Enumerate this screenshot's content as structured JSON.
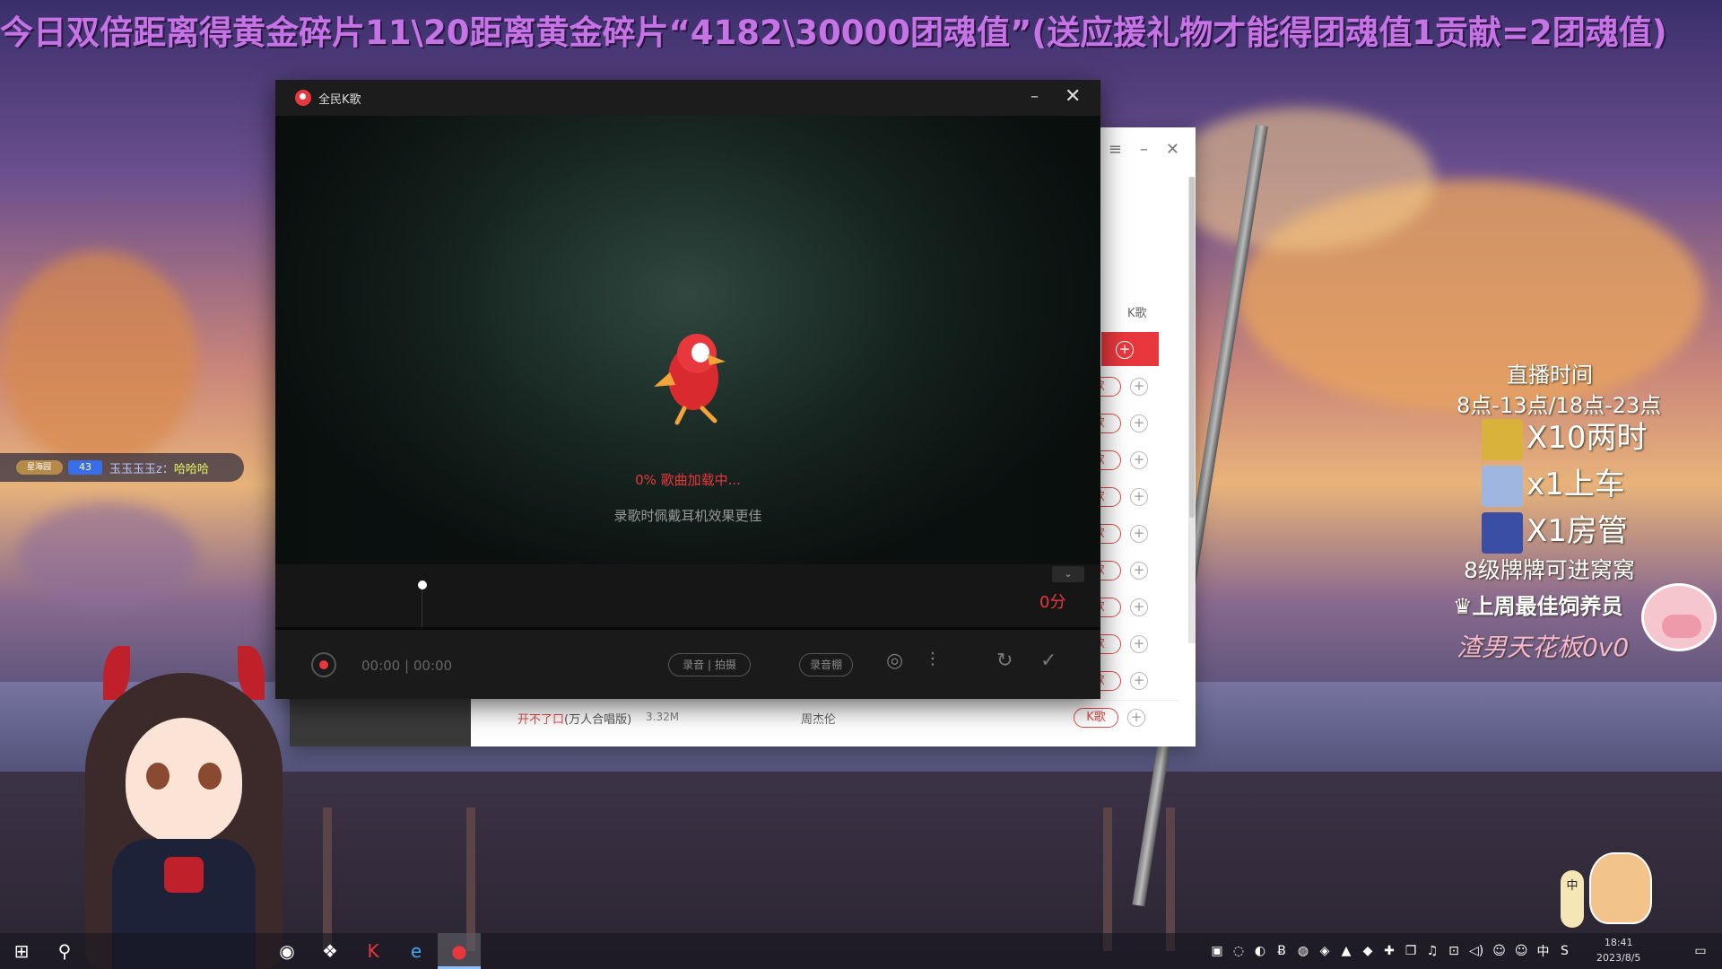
{
  "banner": {
    "text": "今日双倍距离得黄金碎片11\\20距离黄金碎片“4182\\30000团魂值”(送应援礼物才能得团魂值1贡献=2团魂值)"
  },
  "bg_window": {
    "column_k": "K歌",
    "row_button_label": "K歌",
    "row_button_partial": "歌",
    "plus_icon": "+",
    "last_row": {
      "song": "开不了口",
      "song_sub": "(万人合唱版)",
      "size": "3.32M",
      "artist": "周杰伦"
    }
  },
  "ktv_window": {
    "title": "全民K歌",
    "loading_text": "0% 歌曲加载中...",
    "tip_text": "录歌时佩戴耳机效果更佳",
    "score": "0分",
    "time_text": "00:00 | 00:00",
    "record_photo_label": "录音 | 拍摄",
    "studio_label": "录音棚"
  },
  "chat": {
    "badge": "星海园",
    "level": "43",
    "username": "玉玉玉玉z：",
    "message": "哈哈哈"
  },
  "info": {
    "title": "直播时间",
    "hours": "8点-13点/18点-23点",
    "gifts": [
      {
        "label": "X10两时",
        "color": "#d8b23a"
      },
      {
        "label": "x1上车",
        "color": "#9fb7e0"
      },
      {
        "label": "X1房管",
        "color": "#3b4ea6"
      }
    ],
    "level_text": "8级牌牌可进窝窝",
    "weekly_text": "上周最佳饲养员",
    "weekly_name": "渣男天花板0v0"
  },
  "taskbar": {
    "ime_float": "中",
    "tray_ime": "中",
    "clock_time": "18:41",
    "clock_date": "2023/8/5"
  }
}
